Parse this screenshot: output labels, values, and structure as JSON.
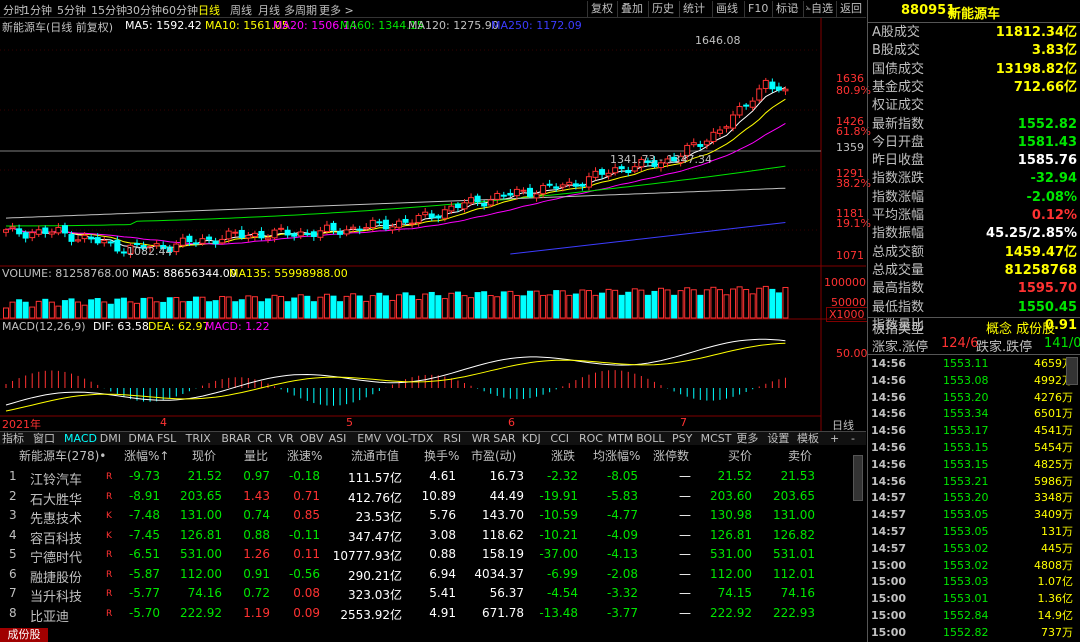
{
  "topbar": {
    "periods": [
      "分时",
      "1分钟",
      "5分钟",
      "15分钟",
      "30分钟",
      "60分钟",
      "日线",
      "周线",
      "月线",
      "多周期",
      "更多 >"
    ],
    "active_period": "日线",
    "buttons": [
      "复权",
      "叠加",
      "历史",
      "统计",
      "画线",
      "F10",
      "标记",
      "-自选",
      "返回"
    ]
  },
  "chart": {
    "title": "新能源车(日线 前复权)",
    "ma": [
      {
        "label": "MA5: 1592.42",
        "color": "#ffffff"
      },
      {
        "label": "MA10: 1561.05",
        "color": "#ffff00"
      },
      {
        "label": "MA20: 1506.14",
        "color": "#ff00ff"
      },
      {
        "label": "MA60: 1344.15",
        "color": "#00e600"
      },
      {
        "label": "MA120: 1275.90",
        "color": "#c0c0c0"
      },
      {
        "label": "MA250: 1172.09",
        "color": "#3c3cff"
      }
    ],
    "high_label": "1646.08",
    "low_label": "1082.44",
    "range_label": "1341.73 - 1347.34",
    "price_axis": [
      {
        "t": "1636",
        "c": "#ff3232"
      },
      {
        "t": "80.9%",
        "c": "#ff3232"
      },
      {
        "t": "1426",
        "c": "#ff3232"
      },
      {
        "t": "61.8%",
        "c": "#ff3232"
      },
      {
        "t": "1359",
        "c": "#c0c0c0"
      },
      {
        "t": "1291",
        "c": "#ff3232"
      },
      {
        "t": "38.2%",
        "c": "#ff3232"
      },
      {
        "t": "1181",
        "c": "#ff3232"
      },
      {
        "t": "19.1%",
        "c": "#ff3232"
      },
      {
        "t": "1071",
        "c": "#ff3232"
      }
    ],
    "volume_label": "VOLUME: 81258768.00",
    "vol_ma5": "MA5: 88656344.00",
    "vol_ma135": "MA135: 55998988.00",
    "vol_axis": [
      "100000",
      "50000",
      "X1000"
    ],
    "macd_title": "MACD(12,26,9)",
    "macd_dif": "DIF: 63.58",
    "macd_dea": "DEA: 62.97",
    "macd_val": "MACD: 1.22",
    "macd_axis": "50.00",
    "date_labels": [
      "2021年",
      "4",
      "5",
      "6",
      "7"
    ],
    "corner_label": "日线"
  },
  "indicator_tabs": [
    "指标",
    "窗口",
    "MACD",
    "DMI",
    "DMA",
    "FSL",
    "TRIX",
    "BRAR",
    "CR",
    "VR",
    "OBV",
    "ASI",
    "EMV",
    "VOL-TDX",
    "RSI",
    "WR",
    "SAR",
    "KDJ",
    "CCI",
    "ROC",
    "MTM",
    "BOLL",
    "PSY",
    "MCST",
    "更多",
    "设置",
    "模板",
    "+",
    "-"
  ],
  "table": {
    "headers": [
      "新能源车(278)•",
      "涨幅%↑",
      "现价",
      "量比",
      "涨速%",
      "流通市值",
      "换手%",
      "市盈(动)",
      "涨跌",
      "均涨幅%",
      "涨停数",
      "买价",
      "卖价"
    ],
    "rows": [
      {
        "n": "1",
        "name": "江铃汽车",
        "tag": "R",
        "pct": "-9.73",
        "price": "21.52",
        "vr": "0.97",
        "spd": "-0.18",
        "cap": "111.57亿",
        "turn": "4.61",
        "pe": "16.73",
        "chg": "-2.32",
        "avg": "-8.05",
        "lim": "—",
        "bid": "21.52",
        "ask": "21.53"
      },
      {
        "n": "2",
        "name": "石大胜华",
        "tag": "R",
        "pct": "-8.91",
        "price": "203.65",
        "vr": "1.43",
        "spd": "0.71",
        "cap": "412.76亿",
        "turn": "10.89",
        "pe": "44.49",
        "chg": "-19.91",
        "avg": "-5.83",
        "lim": "—",
        "bid": "203.60",
        "ask": "203.65"
      },
      {
        "n": "3",
        "name": "先惠技术",
        "tag": "K",
        "pct": "-7.48",
        "price": "131.00",
        "vr": "0.74",
        "spd": "0.85",
        "cap": "23.53亿",
        "turn": "5.76",
        "pe": "143.70",
        "chg": "-10.59",
        "avg": "-4.77",
        "lim": "—",
        "bid": "130.98",
        "ask": "131.00"
      },
      {
        "n": "4",
        "name": "容百科技",
        "tag": "K",
        "pct": "-7.45",
        "price": "126.81",
        "vr": "0.88",
        "spd": "-0.11",
        "cap": "347.47亿",
        "turn": "3.08",
        "pe": "118.62",
        "chg": "-10.21",
        "avg": "-4.09",
        "lim": "—",
        "bid": "126.81",
        "ask": "126.82"
      },
      {
        "n": "5",
        "name": "宁德时代",
        "tag": "R",
        "pct": "-6.51",
        "price": "531.00",
        "vr": "1.26",
        "spd": "0.11",
        "cap": "10777.93亿",
        "turn": "0.88",
        "pe": "158.19",
        "chg": "-37.00",
        "avg": "-4.13",
        "lim": "—",
        "bid": "531.00",
        "ask": "531.01"
      },
      {
        "n": "6",
        "name": "融捷股份",
        "tag": "R",
        "pct": "-5.87",
        "price": "112.00",
        "vr": "0.91",
        "spd": "-0.56",
        "cap": "290.21亿",
        "turn": "6.94",
        "pe": "4034.37",
        "chg": "-6.99",
        "avg": "-2.08",
        "lim": "—",
        "bid": "112.00",
        "ask": "112.01"
      },
      {
        "n": "7",
        "name": "当升科技",
        "tag": "R",
        "pct": "-5.77",
        "price": "74.16",
        "vr": "0.72",
        "spd": "0.08",
        "cap": "323.03亿",
        "turn": "5.41",
        "pe": "56.37",
        "chg": "-4.54",
        "avg": "-3.32",
        "lim": "—",
        "bid": "74.15",
        "ask": "74.16"
      },
      {
        "n": "8",
        "name": "比亚迪",
        "tag": "R",
        "pct": "-5.70",
        "price": "222.92",
        "vr": "1.19",
        "spd": "0.09",
        "cap": "2553.92亿",
        "turn": "4.91",
        "pe": "671.78",
        "chg": "-13.48",
        "avg": "-3.77",
        "lim": "—",
        "bid": "222.92",
        "ask": "222.93"
      }
    ]
  },
  "bottom_badge": "成份股",
  "right_panel": {
    "code": "880951",
    "name": "新能源车",
    "quotes": [
      {
        "k": "A股成交",
        "v": "11812.34亿",
        "c": "yel"
      },
      {
        "k": "B股成交",
        "v": "3.83亿",
        "c": "yel"
      },
      {
        "k": "国债成交",
        "v": "13198.82亿",
        "c": "yel"
      },
      {
        "k": "基金成交",
        "v": "712.66亿",
        "c": "yel"
      },
      {
        "k": "权证成交",
        "v": "",
        "c": "yel"
      },
      {
        "k": "最新指数",
        "v": "1552.82",
        "c": "grn"
      },
      {
        "k": "今日开盘",
        "v": "1581.43",
        "c": "grn"
      },
      {
        "k": "昨日收盘",
        "v": "1585.76",
        "c": "wht"
      },
      {
        "k": "指数涨跌",
        "v": "-32.94",
        "c": "grn"
      },
      {
        "k": "指数涨幅",
        "v": "-2.08%",
        "c": "grn"
      },
      {
        "k": "平均涨幅",
        "v": "0.12%",
        "c": "red"
      },
      {
        "k": "指数振幅",
        "v": "45.25/2.85%",
        "c": "wht"
      },
      {
        "k": "总成交额",
        "v": "1459.47亿",
        "c": "yel"
      },
      {
        "k": "总成交量",
        "v": "81258768",
        "c": "yel"
      },
      {
        "k": "最高指数",
        "v": "1595.70",
        "c": "red"
      },
      {
        "k": "最低指数",
        "v": "1550.45",
        "c": "grn"
      },
      {
        "k": "指数量比",
        "v": "0.91",
        "c": "yel"
      }
    ],
    "type_label": "板指类型",
    "type_value": "概念 成份股",
    "up_label": "涨家.涨停",
    "up_value": "124/6",
    "down_label": "跌家.跌停",
    "down_value": "141/0",
    "ticks": [
      {
        "t": "14:56",
        "p": "1553.11",
        "v": "4659万"
      },
      {
        "t": "14:56",
        "p": "1553.08",
        "v": "4992万"
      },
      {
        "t": "14:56",
        "p": "1553.20",
        "v": "4276万"
      },
      {
        "t": "14:56",
        "p": "1553.34",
        "v": "6501万"
      },
      {
        "t": "14:56",
        "p": "1553.17",
        "v": "4541万"
      },
      {
        "t": "14:56",
        "p": "1553.15",
        "v": "5454万"
      },
      {
        "t": "14:56",
        "p": "1553.15",
        "v": "4825万"
      },
      {
        "t": "14:56",
        "p": "1553.21",
        "v": "5986万"
      },
      {
        "t": "14:57",
        "p": "1553.20",
        "v": "3348万"
      },
      {
        "t": "14:57",
        "p": "1553.05",
        "v": "3409万"
      },
      {
        "t": "14:57",
        "p": "1553.05",
        "v": "131万"
      },
      {
        "t": "14:57",
        "p": "1553.02",
        "v": "445万"
      },
      {
        "t": "15:00",
        "p": "1553.02",
        "v": "4808万"
      },
      {
        "t": "15:00",
        "p": "1553.03",
        "v": "1.07亿"
      },
      {
        "t": "15:00",
        "p": "1553.01",
        "v": "1.36亿"
      },
      {
        "t": "15:00",
        "p": "1552.84",
        "v": "14.9亿"
      },
      {
        "t": "15:00",
        "p": "1552.82",
        "v": "737万"
      }
    ]
  }
}
